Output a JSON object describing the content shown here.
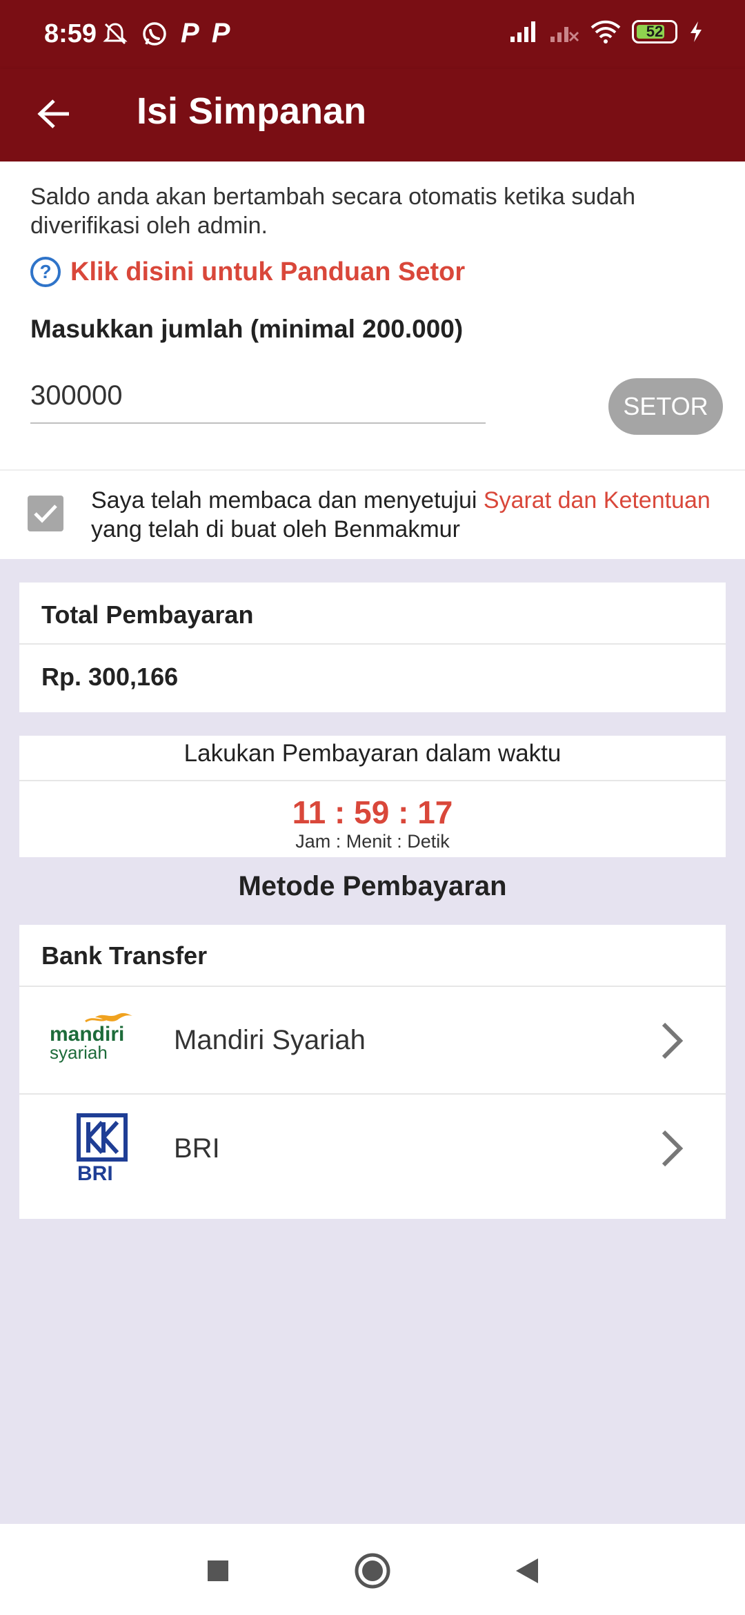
{
  "status_bar": {
    "time": "8:59",
    "battery_level": "52",
    "icons_left": [
      "mute-icon",
      "whatsapp-icon",
      "p-icon",
      "p-icon"
    ],
    "icons_right": [
      "signal-icon",
      "signal-off-icon",
      "wifi-icon",
      "battery-icon",
      "charging-icon"
    ]
  },
  "app_bar": {
    "title": "Isi Simpanan"
  },
  "deposit": {
    "info": "Saldo anda akan bertambah secara otomatis ketika sudah diverifikasi oleh admin.",
    "guide_link": "Klik disini untuk Panduan Setor",
    "amount_label": "Masukkan jumlah (minimal 200.000)",
    "amount_value": "300000",
    "submit_label": "SETOR"
  },
  "terms": {
    "checked": true,
    "prefix": "Saya telah membaca dan menyetujui ",
    "link": "Syarat dan Ketentuan",
    "suffix": " yang telah di buat oleh Benmakmur"
  },
  "total": {
    "label": "Total Pembayaran",
    "value": "Rp. 300,166"
  },
  "timer": {
    "label": "Lakukan Pembayaran dalam waktu",
    "time": "11 : 59 : 17",
    "units": "Jam : Menit : Detik"
  },
  "methods": {
    "title": "Metode Pembayaran",
    "group": "Bank Transfer",
    "banks": [
      {
        "name": "Mandiri Syariah",
        "logo_text_1": "mandiri",
        "logo_text_2": "syariah"
      },
      {
        "name": "BRI",
        "logo_text": "BRI"
      }
    ]
  },
  "colors": {
    "primary": "#7a0e14",
    "accent": "#d9473a",
    "background": "#e6e3f0"
  }
}
